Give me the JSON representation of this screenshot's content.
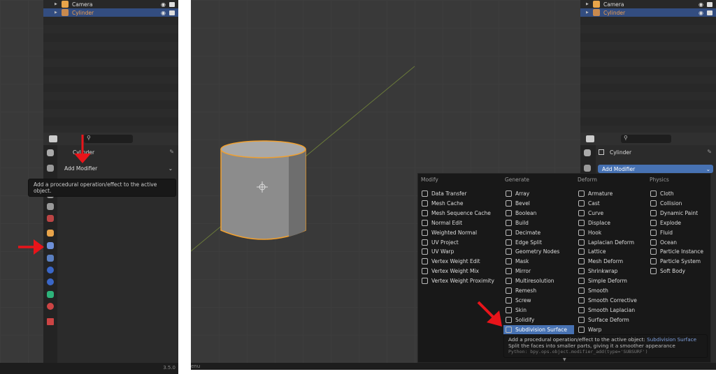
{
  "outliner": {
    "items": [
      {
        "label": "Camera",
        "color": "#e8a44a"
      },
      {
        "label": "Cylinder",
        "color": "#e8a44a",
        "selected": true
      }
    ]
  },
  "properties": {
    "object_name_left": "Cylinder",
    "object_name_right": "Cylinder",
    "add_modifier": "Add Modifier"
  },
  "tooltip_left": "Add a procedural operation/effect to the active object.",
  "status": {
    "version": "3.5.0",
    "left_text": "enu"
  },
  "menu": {
    "columns": [
      {
        "title": "Modify",
        "items": [
          "Data Transfer",
          "Mesh Cache",
          "Mesh Sequence Cache",
          "Normal Edit",
          "Weighted Normal",
          "UV Project",
          "UV Warp",
          "Vertex Weight Edit",
          "Vertex Weight Mix",
          "Vertex Weight Proximity"
        ]
      },
      {
        "title": "Generate",
        "items": [
          "Array",
          "Bevel",
          "Boolean",
          "Build",
          "Decimate",
          "Edge Split",
          "Geometry Nodes",
          "Mask",
          "Mirror",
          "Multiresolution",
          "Remesh",
          "Screw",
          "Skin",
          "Solidify",
          "Subdivision Surface"
        ]
      },
      {
        "title": "Deform",
        "items": [
          "Armature",
          "Cast",
          "Curve",
          "Displace",
          "Hook",
          "Laplacian Deform",
          "Lattice",
          "Mesh Deform",
          "Shrinkwrap",
          "Simple Deform",
          "Smooth",
          "Smooth Corrective",
          "Smooth Laplacian",
          "Surface Deform",
          "Warp"
        ]
      },
      {
        "title": "Physics",
        "items": [
          "Cloth",
          "Collision",
          "Dynamic Paint",
          "Explode",
          "Fluid",
          "Ocean",
          "Particle Instance",
          "Particle System",
          "Soft Body"
        ]
      }
    ],
    "highlighted": "Subdivision Surface",
    "tooltip": {
      "title": "Add a procedural operation/effect to the active object:",
      "highlight": "Subdivision Surface",
      "description": "Split the faces into smaller parts, giving it a smoother appearance",
      "python": "Python: bpy.ops.object.modifier_add(type='SUBSURF')"
    }
  },
  "colors": {
    "accent": "#4772b3",
    "selection": "#334d80",
    "arrow": "#e8141a"
  }
}
